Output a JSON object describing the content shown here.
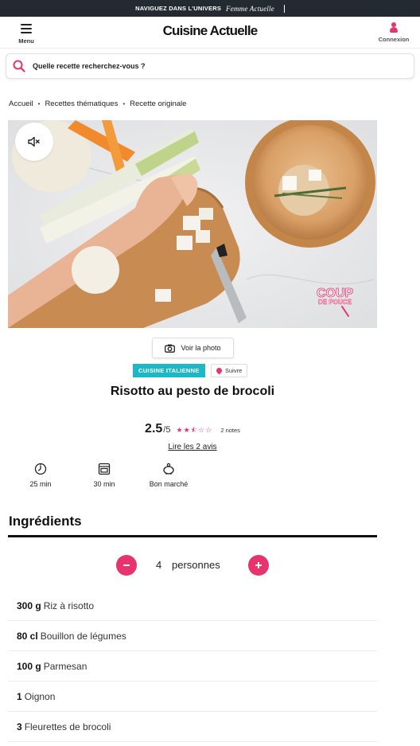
{
  "topbar": {
    "text": "NAVIGUEZ DANS L'UNIVERS",
    "brand": "Femme Actuelle"
  },
  "header": {
    "menu_label": "Menu",
    "logo": "Cuisine Actuelle",
    "login_label": "Connexion"
  },
  "search": {
    "placeholder": "Quelle recette recherchez-vous ?"
  },
  "breadcrumb": [
    "Accueil",
    "Recettes thématiques",
    "Recette originale"
  ],
  "media": {
    "watermark_line1": "COUP",
    "watermark_line2": "DE POUCE",
    "photo_button": "Voir la photo"
  },
  "tags": {
    "category": "CUISINE ITALIENNE",
    "follow": "Suivre"
  },
  "recipe": {
    "title": "Risotto au pesto de brocoli",
    "rating_value": "2.5",
    "rating_max": "/5",
    "rating_stars": 2.5,
    "rating_count": "2 notes",
    "reviews_link": "Lire les 2 avis",
    "info": {
      "time": "25 min",
      "cook": "30 min",
      "price": "Bon marché"
    }
  },
  "ingredients": {
    "title": "Ingrédients",
    "servings": "4",
    "servings_unit": "personnes",
    "items": [
      {
        "qty": "300 g",
        "name": "Riz à risotto"
      },
      {
        "qty": "80 cl",
        "name": "Bouillon de légumes"
      },
      {
        "qty": "100 g",
        "name": "Parmesan"
      },
      {
        "qty": "1",
        "name": "Oignon"
      },
      {
        "qty": "3",
        "name": "Fleurettes de brocoli"
      }
    ]
  },
  "colors": {
    "accent": "#e8336c",
    "tag": "#1cb8c6",
    "topbar": "#232a31"
  }
}
